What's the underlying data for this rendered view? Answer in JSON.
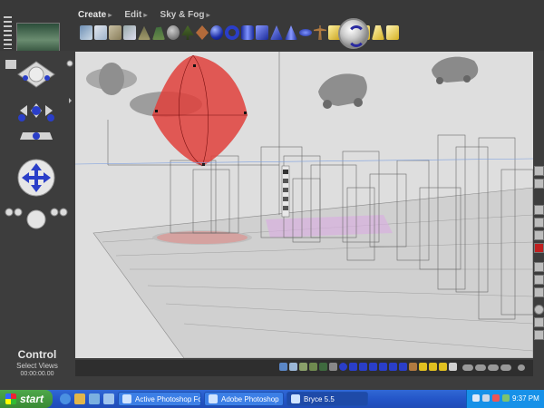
{
  "app": {
    "title": "Bryce 5.5"
  },
  "menus": [
    {
      "label": "Create"
    },
    {
      "label": "Edit"
    },
    {
      "label": "Sky & Fog"
    }
  ],
  "control_panel": {
    "title": "Control",
    "subtitle": "Select Views",
    "timecode": "00:00:00.00"
  },
  "taskbar": {
    "start_label": "start",
    "tasks": [
      {
        "label": "Active Photoshop For..."
      },
      {
        "label": "Adobe Photoshop"
      },
      {
        "label": "Bryce 5.5"
      }
    ],
    "clock": "9:37 PM"
  },
  "colors": {
    "accent_blue": "#2a3ec8",
    "terrain_red": "#e0413c",
    "selection_pink": "#d490e0"
  }
}
